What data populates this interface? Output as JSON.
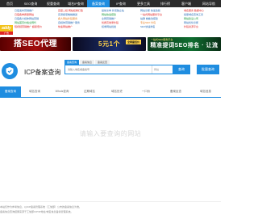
{
  "nav": {
    "items": [
      {
        "label": "首页"
      },
      {
        "label": "SEO查询"
      },
      {
        "label": "权重查询"
      },
      {
        "label": "域名IP查询"
      },
      {
        "label": "备案查询"
      },
      {
        "label": "IP查询"
      },
      {
        "label": "更多工具"
      },
      {
        "label": "排行榜"
      },
      {
        "label": "客户端"
      },
      {
        "label": "网站导航"
      }
    ],
    "active_index": 4
  },
  "ads": {
    "col1": [
      "日夜发布营销推广",
      "日夜各单质量网站",
      "日夜各大媒体网站营销",
      "网站首页价格全网代",
      "短视频营销推广 超级低价"
    ],
    "col2": [
      "百度二权 网站权重打造",
      "实测各项蜘蛛推送",
      "各大网站外链服务",
      "自媒体营销推广服务",
      "快速网站推广"
    ],
    "col3": [
      "提前交单 外贸独立站",
      "网站快速搭建",
      "全网营销推广",
      "优质高收录外链",
      "权重网站批发"
    ],
    "col4": [
      "网站诊断 快速改版",
      "一站式网站服务平台",
      "站群 蜘蛛池搭建",
      "专业SEO 外包",
      "SEO快速排名"
    ],
    "col5": [
      "域名服务 数据中心",
      "批量域名查询工具",
      "网站建设公司",
      "网站优化诊断",
      "外链资源平台"
    ],
    "daddy_label": "addy",
    "ad_badge": "广告",
    "banner1_text": "搭SEO代理",
    "banner2_text": "5元1个",
    "banner2_tag": "全网最低价",
    "banner3_top": "一站式SEO服务平台",
    "banner3_text": "精准提词SEO排名 · 让流量增长"
  },
  "search": {
    "logo_label": "ICP备案查询",
    "tabs": [
      "备案查询",
      "备案信息",
      "备案反查",
      "ICP备案"
    ],
    "active_tab": 0,
    "placeholder": "请输入域名或备案号",
    "select_value": "网站",
    "button_label": "查询",
    "second_button_label": "批量查询"
  },
  "result_tabs": {
    "items": [
      "备案查询",
      "域名查询",
      "Whois查询",
      "过期域名",
      "域名历史",
      "一口价",
      "备案反查",
      "域名信息"
    ],
    "active_index": 0
  },
  "empty_state": {
    "text": "请输入要查询的网站"
  },
  "footer": {
    "line1": "本站仅作为参考信息，以ICP备案管理系统（工信部）公布的备案信息为准。",
    "line2": "备案信息查询结果来源于工信部ICP/IP地址/域名信息备案管理系统。"
  }
}
